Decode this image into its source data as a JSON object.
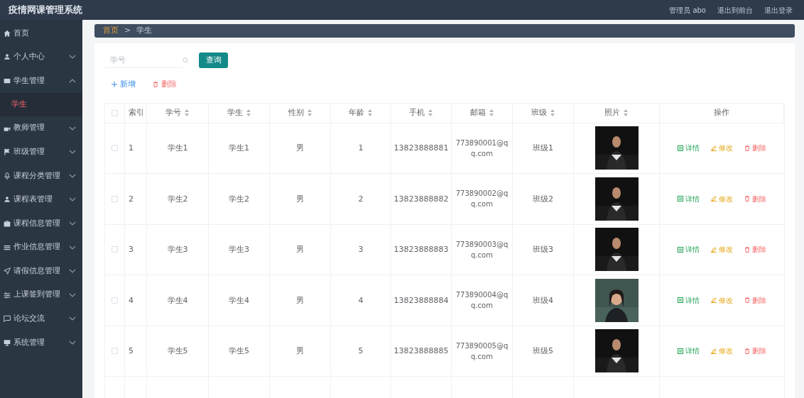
{
  "header": {
    "title": "疫情网课管理系统",
    "user": "管理员 abo",
    "links": [
      "退出到前台",
      "退出登录"
    ]
  },
  "sidebar": {
    "items": [
      {
        "label": "首页"
      },
      {
        "label": "个人中心",
        "expanded": false
      },
      {
        "label": "学生管理",
        "expanded": true,
        "children": [
          {
            "label": "学生",
            "selected": true
          }
        ]
      },
      {
        "label": "教师管理",
        "expanded": false
      },
      {
        "label": "班级管理",
        "expanded": false
      },
      {
        "label": "课程分类管理",
        "expanded": false
      },
      {
        "label": "课程表管理",
        "expanded": false
      },
      {
        "label": "课程信息管理",
        "expanded": false
      },
      {
        "label": "作业信息管理",
        "expanded": false
      },
      {
        "label": "请假信息管理",
        "expanded": false
      },
      {
        "label": "上课签到管理",
        "expanded": false
      },
      {
        "label": "论坛交流",
        "expanded": false
      },
      {
        "label": "系统管理",
        "expanded": false
      }
    ]
  },
  "breadcrumb": {
    "separator": ">",
    "items": [
      {
        "label": "首页",
        "selected": false
      },
      {
        "label": "学生",
        "selected": true
      }
    ]
  },
  "search": {
    "placeholder": "学号",
    "button": "查询"
  },
  "toolbar": {
    "add": "新增",
    "delete": "删除"
  },
  "table": {
    "all_checked": false,
    "columns": [
      {
        "label": "索引",
        "sortable": false
      },
      {
        "label": "学号",
        "sortable": true
      },
      {
        "label": "学生",
        "sortable": true
      },
      {
        "label": "性别",
        "sortable": true
      },
      {
        "label": "年龄",
        "sortable": true
      },
      {
        "label": "手机",
        "sortable": true
      },
      {
        "label": "邮箱",
        "sortable": true
      },
      {
        "label": "班级",
        "sortable": true
      },
      {
        "label": "照片",
        "sortable": true
      },
      {
        "label": "操作",
        "sortable": false
      }
    ],
    "rows": [
      {
        "checked": false,
        "index": "1",
        "student_no": "学生1",
        "name": "学生1",
        "gender": "男",
        "age": "1",
        "phone": "13823888881",
        "email": "773890001@qq.com",
        "class": "班级1",
        "actions": [
          "详情",
          "修改",
          "删除"
        ]
      },
      {
        "checked": false,
        "index": "2",
        "student_no": "学生2",
        "name": "学生2",
        "gender": "男",
        "age": "2",
        "phone": "13823888882",
        "email": "773890002@qq.com",
        "class": "班级2",
        "actions": [
          "详情",
          "修改",
          "删除"
        ]
      },
      {
        "checked": false,
        "index": "3",
        "student_no": "学生3",
        "name": "学生3",
        "gender": "男",
        "age": "3",
        "phone": "13823888883",
        "email": "773890003@qq.com",
        "class": "班级3",
        "actions": [
          "详情",
          "修改",
          "删除"
        ]
      },
      {
        "checked": false,
        "index": "4",
        "student_no": "学生4",
        "name": "学生4",
        "gender": "男",
        "age": "4",
        "phone": "13823888884",
        "email": "773890004@qq.com",
        "class": "班级4",
        "actions": [
          "详情",
          "修改",
          "删除"
        ]
      },
      {
        "checked": false,
        "index": "5",
        "student_no": "学生5",
        "name": "学生5",
        "gender": "男",
        "age": "5",
        "phone": "13823888885",
        "email": "773890005@qq.com",
        "class": "班级5",
        "actions": [
          "详情",
          "修改",
          "删除"
        ]
      }
    ]
  }
}
